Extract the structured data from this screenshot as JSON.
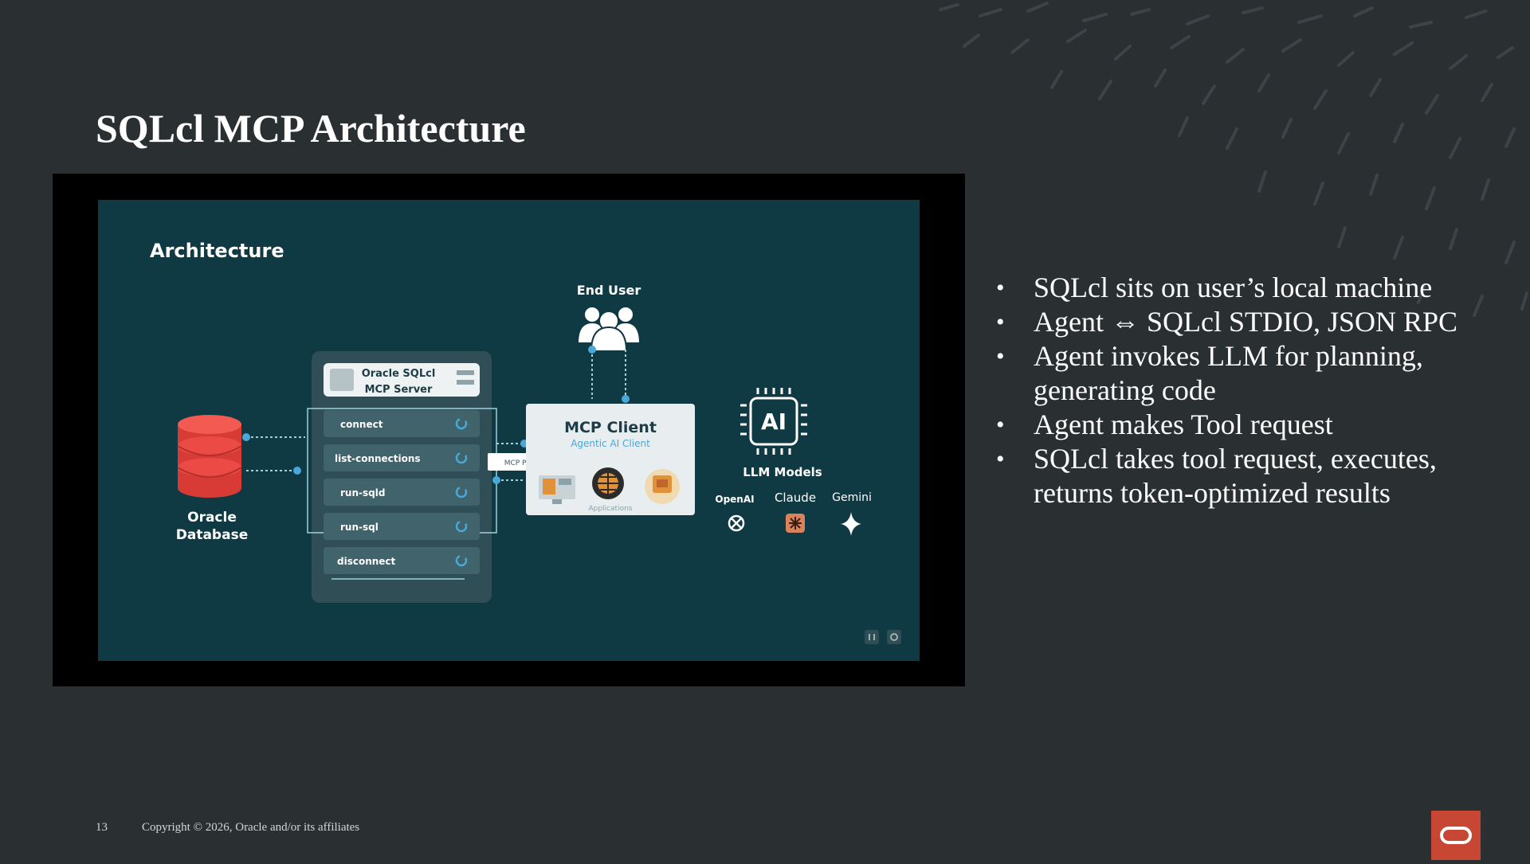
{
  "slide": {
    "title": "SQLcl MCP Architecture",
    "bullets": [
      "SQLcl sits on user’s local machine",
      "Agent ⇔ SQLcl STDIO, JSON RPC",
      "Agent invokes LLM for planning, generating code",
      "Agent makes Tool request",
      "SQLcl takes tool request, executes, returns token-optimized results"
    ],
    "slide_number": "13",
    "copyright": "Copyright © 2026, Oracle and/or its affiliates"
  },
  "diagram": {
    "heading": "Architecture",
    "end_user_label": "End User",
    "server_title_line1": "Oracle SQLcl",
    "server_title_line2": "MCP Server",
    "tools": [
      "connect",
      "list-connections",
      "run-sqld",
      "run-sql",
      "disconnect"
    ],
    "database_line1": "Oracle",
    "database_line2": "Database",
    "protocol_label": "MCP Protocol",
    "client_title": "MCP Client",
    "client_subtitle": "Agentic AI Client",
    "applications_label": "Applications",
    "ai_chip_label": "AI",
    "llm_label": "LLM Models",
    "providers": [
      "OpenAI",
      "Claude",
      "Gemini"
    ]
  },
  "icons": [
    "oracle-logo-icon",
    "database-icon",
    "users-icon",
    "ai-chip-icon",
    "openai-icon",
    "claude-icon",
    "gemini-icon",
    "pause-icon"
  ],
  "colors": {
    "background": "#2a2f31",
    "diagram_bg": "#0f3a44",
    "database_red": "#e8403b",
    "oracle_red": "#c74634"
  }
}
